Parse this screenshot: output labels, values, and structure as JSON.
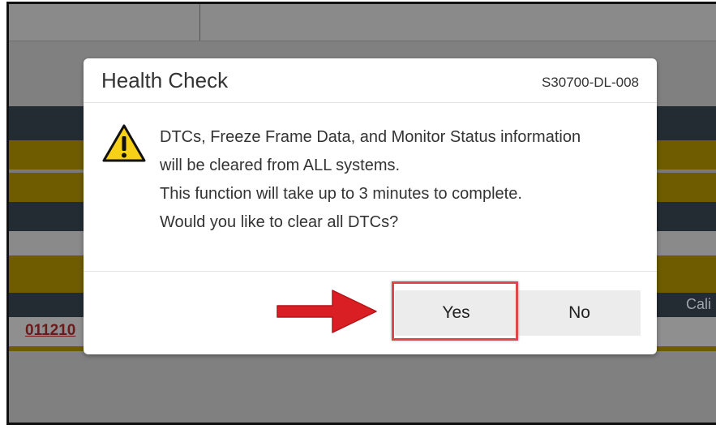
{
  "background": {
    "row_link_text": "011210",
    "column_header_partial": "Cali"
  },
  "dialog": {
    "title": "Health Check",
    "code": "S30700-DL-008",
    "icon": "warning-triangle-icon",
    "message_lines": [
      "DTCs, Freeze Frame Data, and Monitor Status information",
      "will be cleared from ALL systems.",
      "This function will take up to 3 minutes to complete.",
      "Would you like to clear all DTCs?"
    ],
    "yes_label": "Yes",
    "no_label": "No"
  },
  "annotation": {
    "arrow_icon": "red-arrow-right-icon",
    "highlight_color": "#e0474c"
  },
  "colors": {
    "overlay_gray": "#808080",
    "dark_band": "#232b33",
    "gold_band": "#6f5b00",
    "warning_yellow": "#f7d117"
  }
}
